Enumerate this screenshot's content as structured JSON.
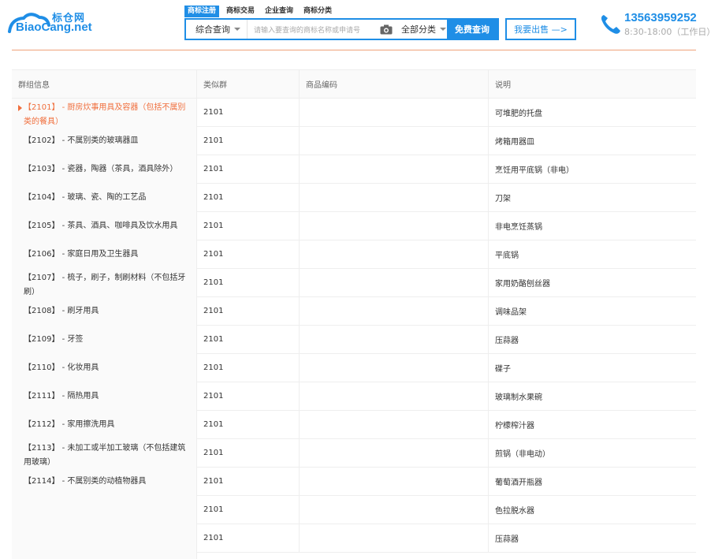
{
  "header": {
    "logo_cn": "标仓网",
    "logo_en": "BiaoCang.net",
    "tabs": [
      "商标注册",
      "商标交易",
      "企业查询",
      "商标分类"
    ],
    "search": {
      "type_label": "综合查询",
      "placeholder": "请输入要查询的商标名称或申请号",
      "category_label": "全部分类",
      "button_label": "免费查询"
    },
    "sell_label": "我要出售 —>",
    "phone_number": "13563959252",
    "phone_hours": "8:30-18:00（工作日）",
    "accent_color": "#1f8ee6",
    "highlight_color": "#f06e3c"
  },
  "left": {
    "header": "群组信息",
    "groups": [
      "【2101】 - 厨房炊事用具及容器（包括不属别类的餐具）",
      "【2102】 - 不属别类的玻璃器皿",
      "【2103】 - 瓷器，陶器（茶具，酒具除外）",
      "【2104】 - 玻璃、瓷、陶的工艺品",
      "【2105】 - 茶具、酒具、咖啡具及饮水用具",
      "【2106】 - 家庭日用及卫生器具",
      "【2107】 - 梳子，刷子，制刷材料（不包括牙刷）",
      "【2108】 - 刷牙用具",
      "【2109】 - 牙签",
      "【2110】 - 化妆用具",
      "【2111】 - 隔热用具",
      "【2112】 - 家用擦洗用具",
      "【2113】 - 未加工或半加工玻璃（不包括建筑用玻璃）",
      "【2114】 - 不属别类的动植物器具"
    ]
  },
  "table": {
    "headers": [
      "类似群",
      "商品编码",
      "说明"
    ],
    "rows": [
      [
        "2101",
        "",
        "可堆肥的托盘"
      ],
      [
        "2101",
        "",
        "烤箱用器皿"
      ],
      [
        "2101",
        "",
        "烹饪用平底锅（非电）"
      ],
      [
        "2101",
        "",
        "刀架"
      ],
      [
        "2101",
        "",
        "非电烹饪蒸锅"
      ],
      [
        "2101",
        "",
        "平底锅"
      ],
      [
        "2101",
        "",
        "家用奶酪刨丝器"
      ],
      [
        "2101",
        "",
        "调味品架"
      ],
      [
        "2101",
        "",
        "压蒜器"
      ],
      [
        "2101",
        "",
        "碟子"
      ],
      [
        "2101",
        "",
        "玻璃制水果碗"
      ],
      [
        "2101",
        "",
        "柠檬榨汁器"
      ],
      [
        "2101",
        "",
        "煎锅（非电动）"
      ],
      [
        "2101",
        "",
        "葡萄酒开瓶器"
      ],
      [
        "2101",
        "",
        "色拉脱水器"
      ],
      [
        "2101",
        "",
        "压蒜器"
      ]
    ]
  }
}
